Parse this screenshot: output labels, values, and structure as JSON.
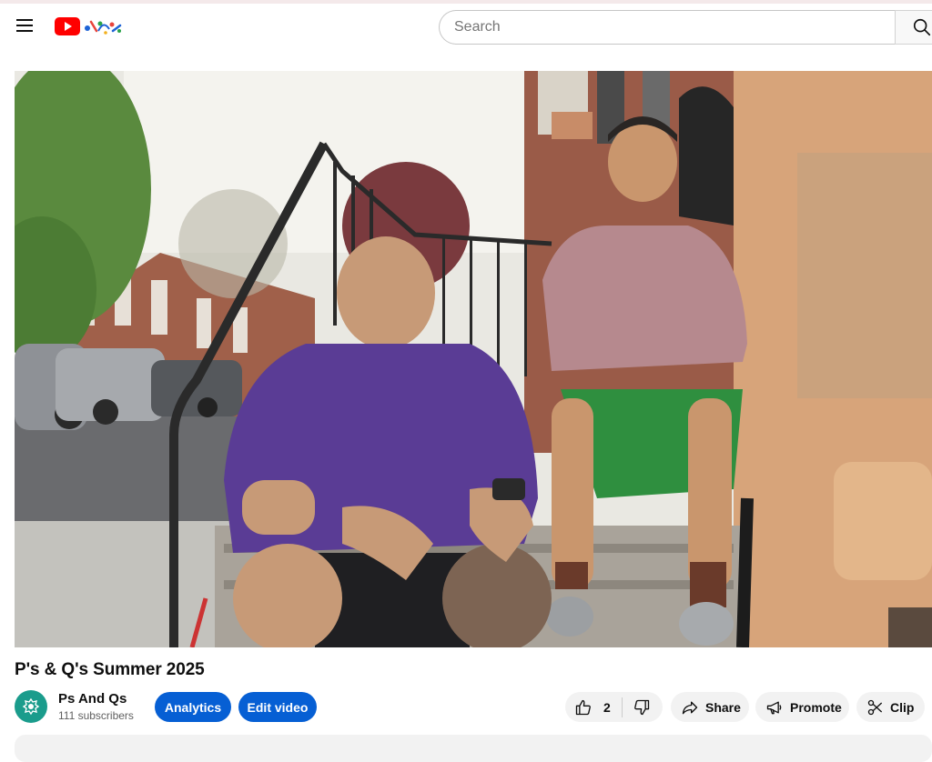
{
  "header": {
    "menu_icon": "hamburger-menu-icon",
    "logo_icon": "youtube-doodle-logo",
    "search_placeholder": "Search",
    "search_icon": "search-icon"
  },
  "video": {
    "title": "P's & Q's Summer 2025"
  },
  "channel": {
    "name": "Ps And Qs",
    "subscribers": "111 subscribers",
    "avatar_icon": "channel-avatar-logo"
  },
  "actions": {
    "analytics_label": "Analytics",
    "edit_label": "Edit video",
    "like_count": "2",
    "share_label": "Share",
    "promote_label": "Promote",
    "clip_label": "Clip"
  },
  "colors": {
    "brand_red": "#ff0000",
    "action_blue": "#065fd4",
    "avatar_teal": "#1a9c8c"
  }
}
